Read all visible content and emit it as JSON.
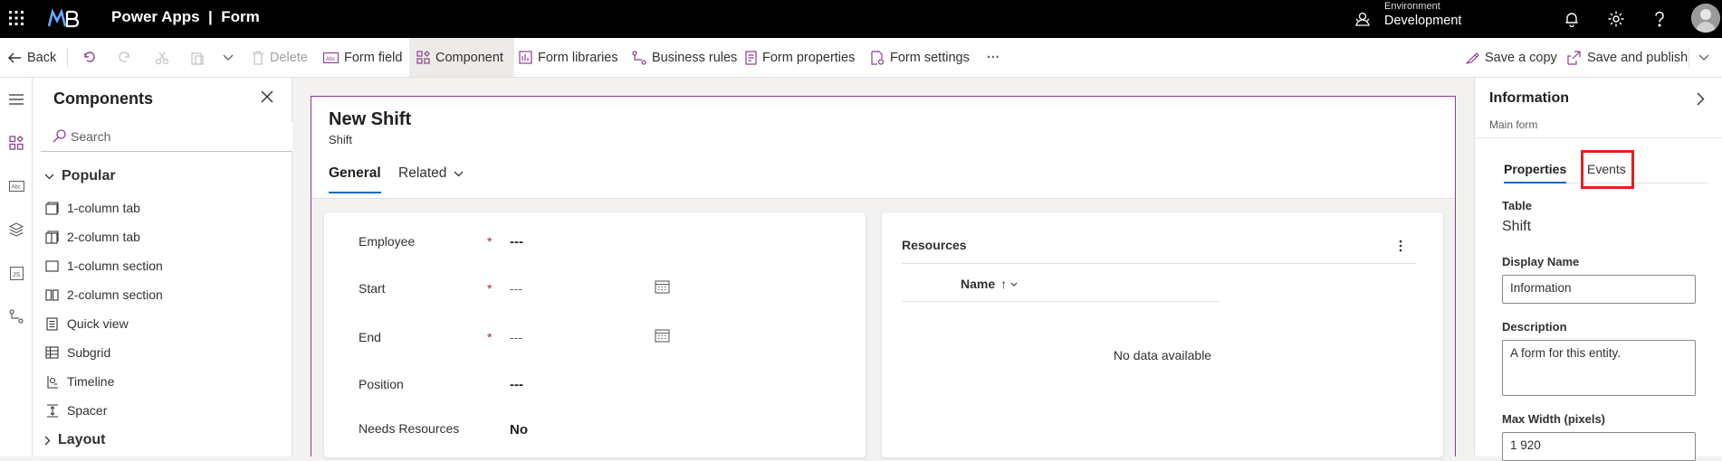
{
  "topbar": {
    "app_title": "Power Apps  |  Form",
    "environment_label": "Environment",
    "environment_value": "Development"
  },
  "commandbar": {
    "back": "Back",
    "delete": "Delete",
    "form_field": "Form field",
    "component": "Component",
    "form_libraries": "Form libraries",
    "business_rules": "Business rules",
    "form_properties": "Form properties",
    "form_settings": "Form settings",
    "more": "···",
    "save_copy": "Save a copy",
    "save_publish": "Save and publish"
  },
  "components": {
    "title": "Components",
    "search_placeholder": "Search",
    "popular_label": "Popular",
    "items": [
      {
        "label": "1-column tab",
        "icon": "one-column-tab-icon"
      },
      {
        "label": "2-column tab",
        "icon": "two-column-tab-icon"
      },
      {
        "label": "1-column section",
        "icon": "one-column-section-icon"
      },
      {
        "label": "2-column section",
        "icon": "two-column-section-icon"
      },
      {
        "label": "Quick view",
        "icon": "quick-view-icon"
      },
      {
        "label": "Subgrid",
        "icon": "subgrid-icon"
      },
      {
        "label": "Timeline",
        "icon": "timeline-icon"
      },
      {
        "label": "Spacer",
        "icon": "spacer-icon"
      }
    ],
    "layout_label": "Layout"
  },
  "form": {
    "name": "New Shift",
    "entity": "Shift",
    "tabs": {
      "general": "General",
      "related": "Related"
    },
    "fields": [
      {
        "label": "Employee",
        "required": "*",
        "value": "---"
      },
      {
        "label": "Start",
        "required": "*",
        "value": "---"
      },
      {
        "label": "End",
        "required": "*",
        "value": "---"
      },
      {
        "label": "Position",
        "required": "",
        "value": "---"
      },
      {
        "label": "Needs Resources",
        "required": "",
        "value": "No"
      }
    ],
    "resources": {
      "title": "Resources",
      "column": "Name",
      "sort_indicator": "↑",
      "empty": "No data available"
    }
  },
  "properties": {
    "title": "Information",
    "subtitle": "Main form",
    "tab_properties": "Properties",
    "tab_events": "Events",
    "table_label": "Table",
    "table_value": "Shift",
    "display_name_label": "Display Name",
    "display_name_value": "Information",
    "description_label": "Description",
    "description_value": "A form for this entity.",
    "max_width_label": "Max Width (pixels)",
    "max_width_value": "1 920"
  },
  "colors": {
    "accent": "#0f6cbd",
    "form_border": "#8a3e8f",
    "highlight_box": "#e02020",
    "required": "#a4262c"
  }
}
